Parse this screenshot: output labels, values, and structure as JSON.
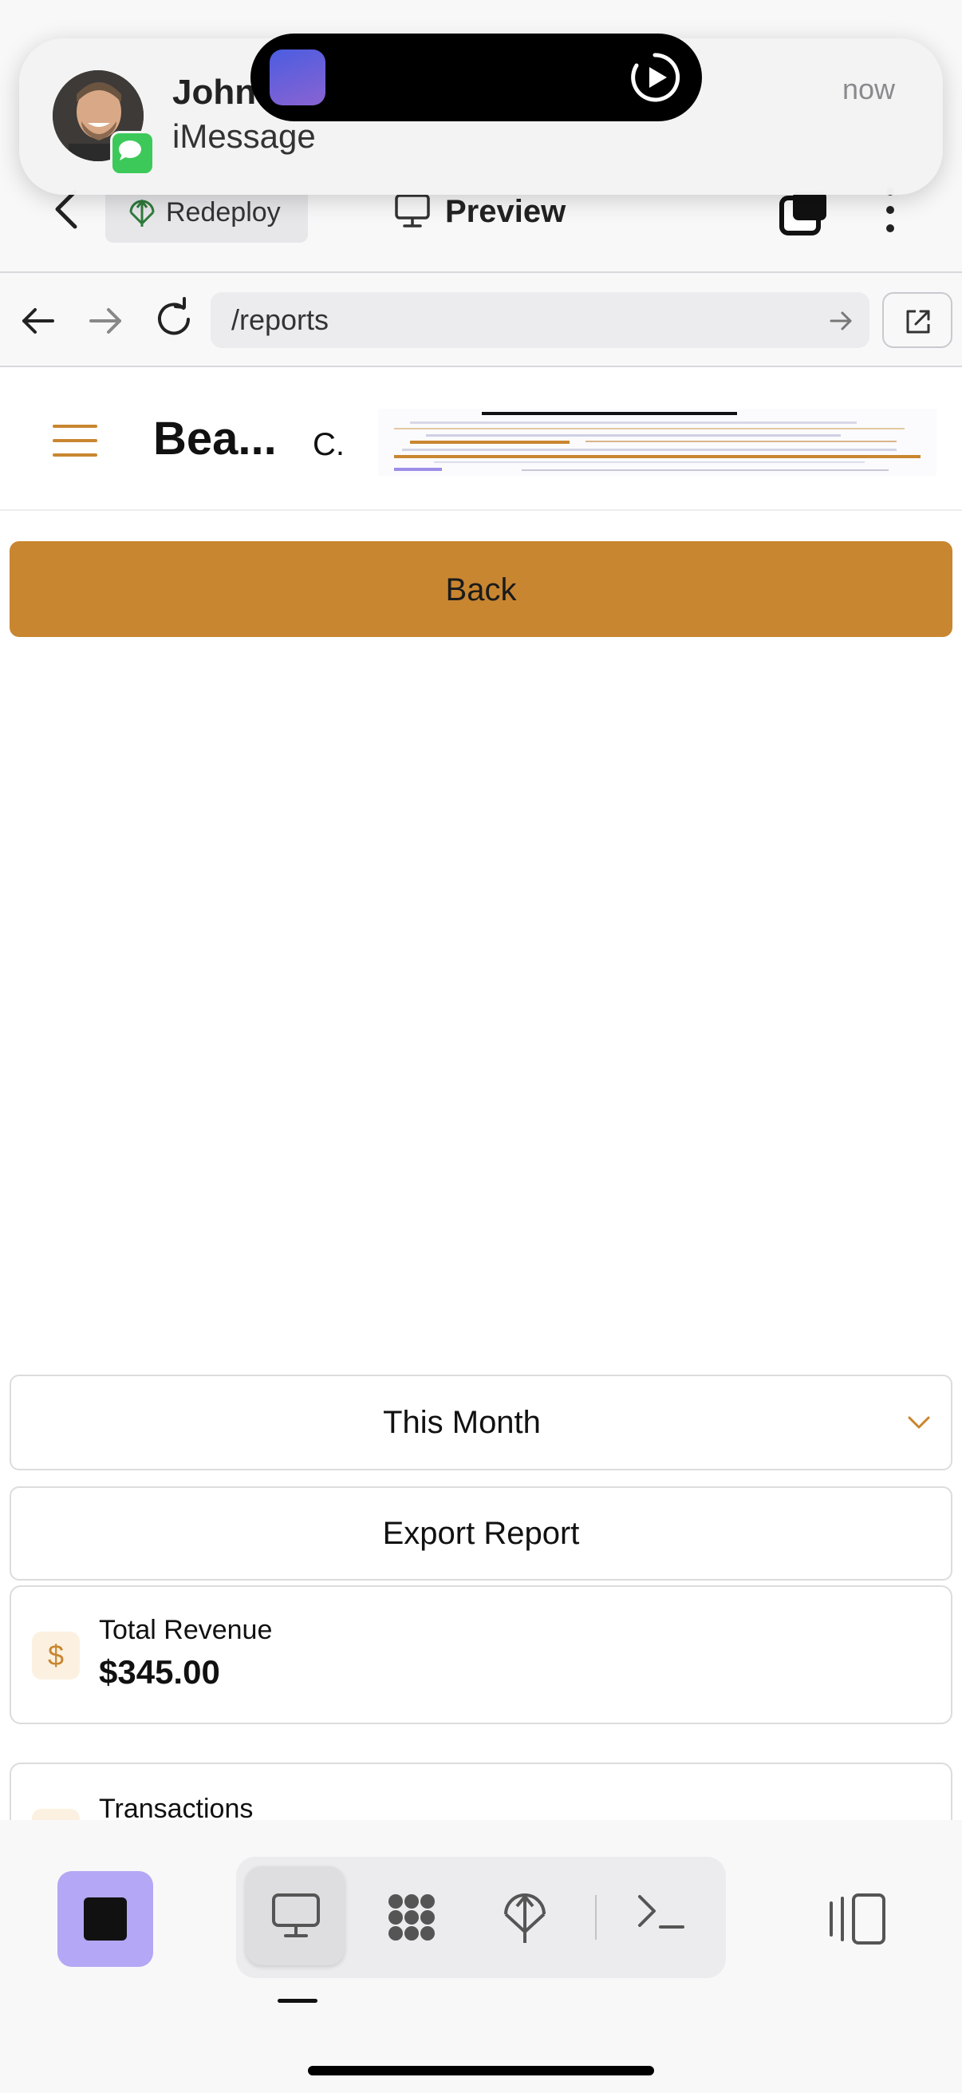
{
  "notification": {
    "sender": "John",
    "app": "iMessage",
    "time": "now"
  },
  "appbar": {
    "redeploy_label": "Redeploy",
    "preview_label": "Preview"
  },
  "browser": {
    "url": "/reports"
  },
  "site": {
    "title": "Bea...",
    "subtitle": "C."
  },
  "content": {
    "back_label": "Back",
    "period_selected": "This Month",
    "export_label": "Export Report",
    "cards": [
      {
        "icon": "$",
        "label": "Total Revenue",
        "value": "$345.00"
      },
      {
        "icon": "",
        "label": "Transactions",
        "value": ""
      }
    ]
  },
  "colors": {
    "accent": "#c98630",
    "stop_button": "#b4a7f5",
    "message_badge": "#3cc95a"
  },
  "toolbar": {
    "icons": [
      "stop-icon",
      "desktop-icon",
      "apps-grid-icon",
      "deploy-icon",
      "terminal-icon",
      "panel-toggle-icon"
    ]
  }
}
